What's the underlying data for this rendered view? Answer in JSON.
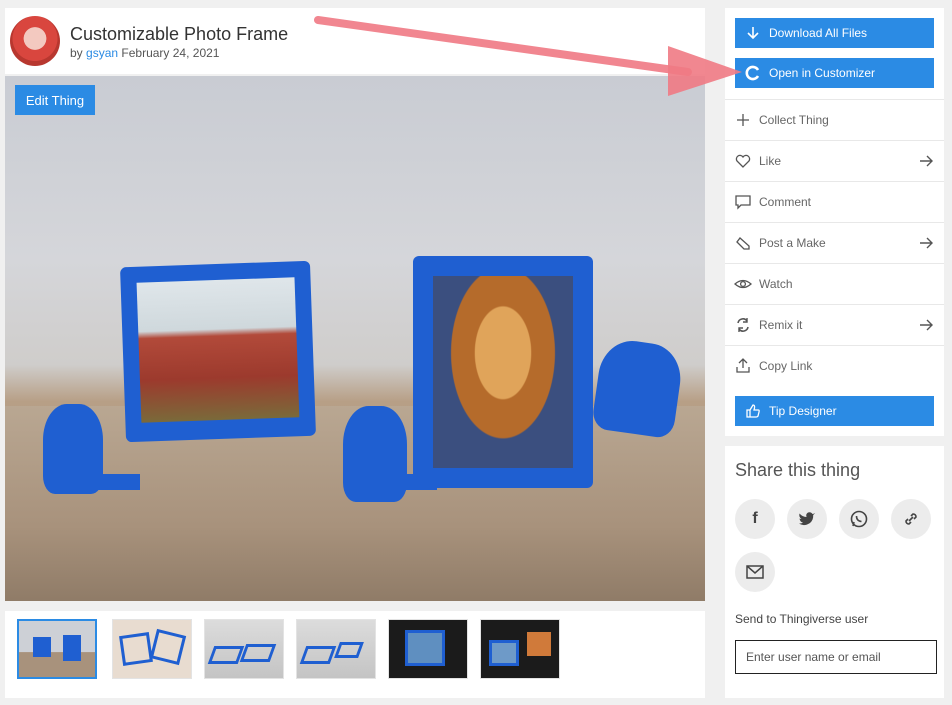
{
  "header": {
    "title": "Customizable Photo Frame",
    "by_prefix": "by",
    "author": "gsyan",
    "date": "February 24, 2021"
  },
  "photo": {
    "edit_label": "Edit Thing"
  },
  "actions": {
    "download_label": "Download All Files",
    "customizer_label": "Open in Customizer",
    "collect_label": "Collect Thing",
    "like_label": "Like",
    "comment_label": "Comment",
    "post_make_label": "Post a Make",
    "watch_label": "Watch",
    "remix_label": "Remix it",
    "copy_link_label": "Copy Link",
    "tip_label": "Tip Designer"
  },
  "share": {
    "title": "Share this thing",
    "send_label": "Send to Thingiverse user",
    "send_placeholder": "Enter user name or email"
  },
  "colors": {
    "accent": "#2b8be4",
    "annotation_arrow": "#f07a84"
  }
}
